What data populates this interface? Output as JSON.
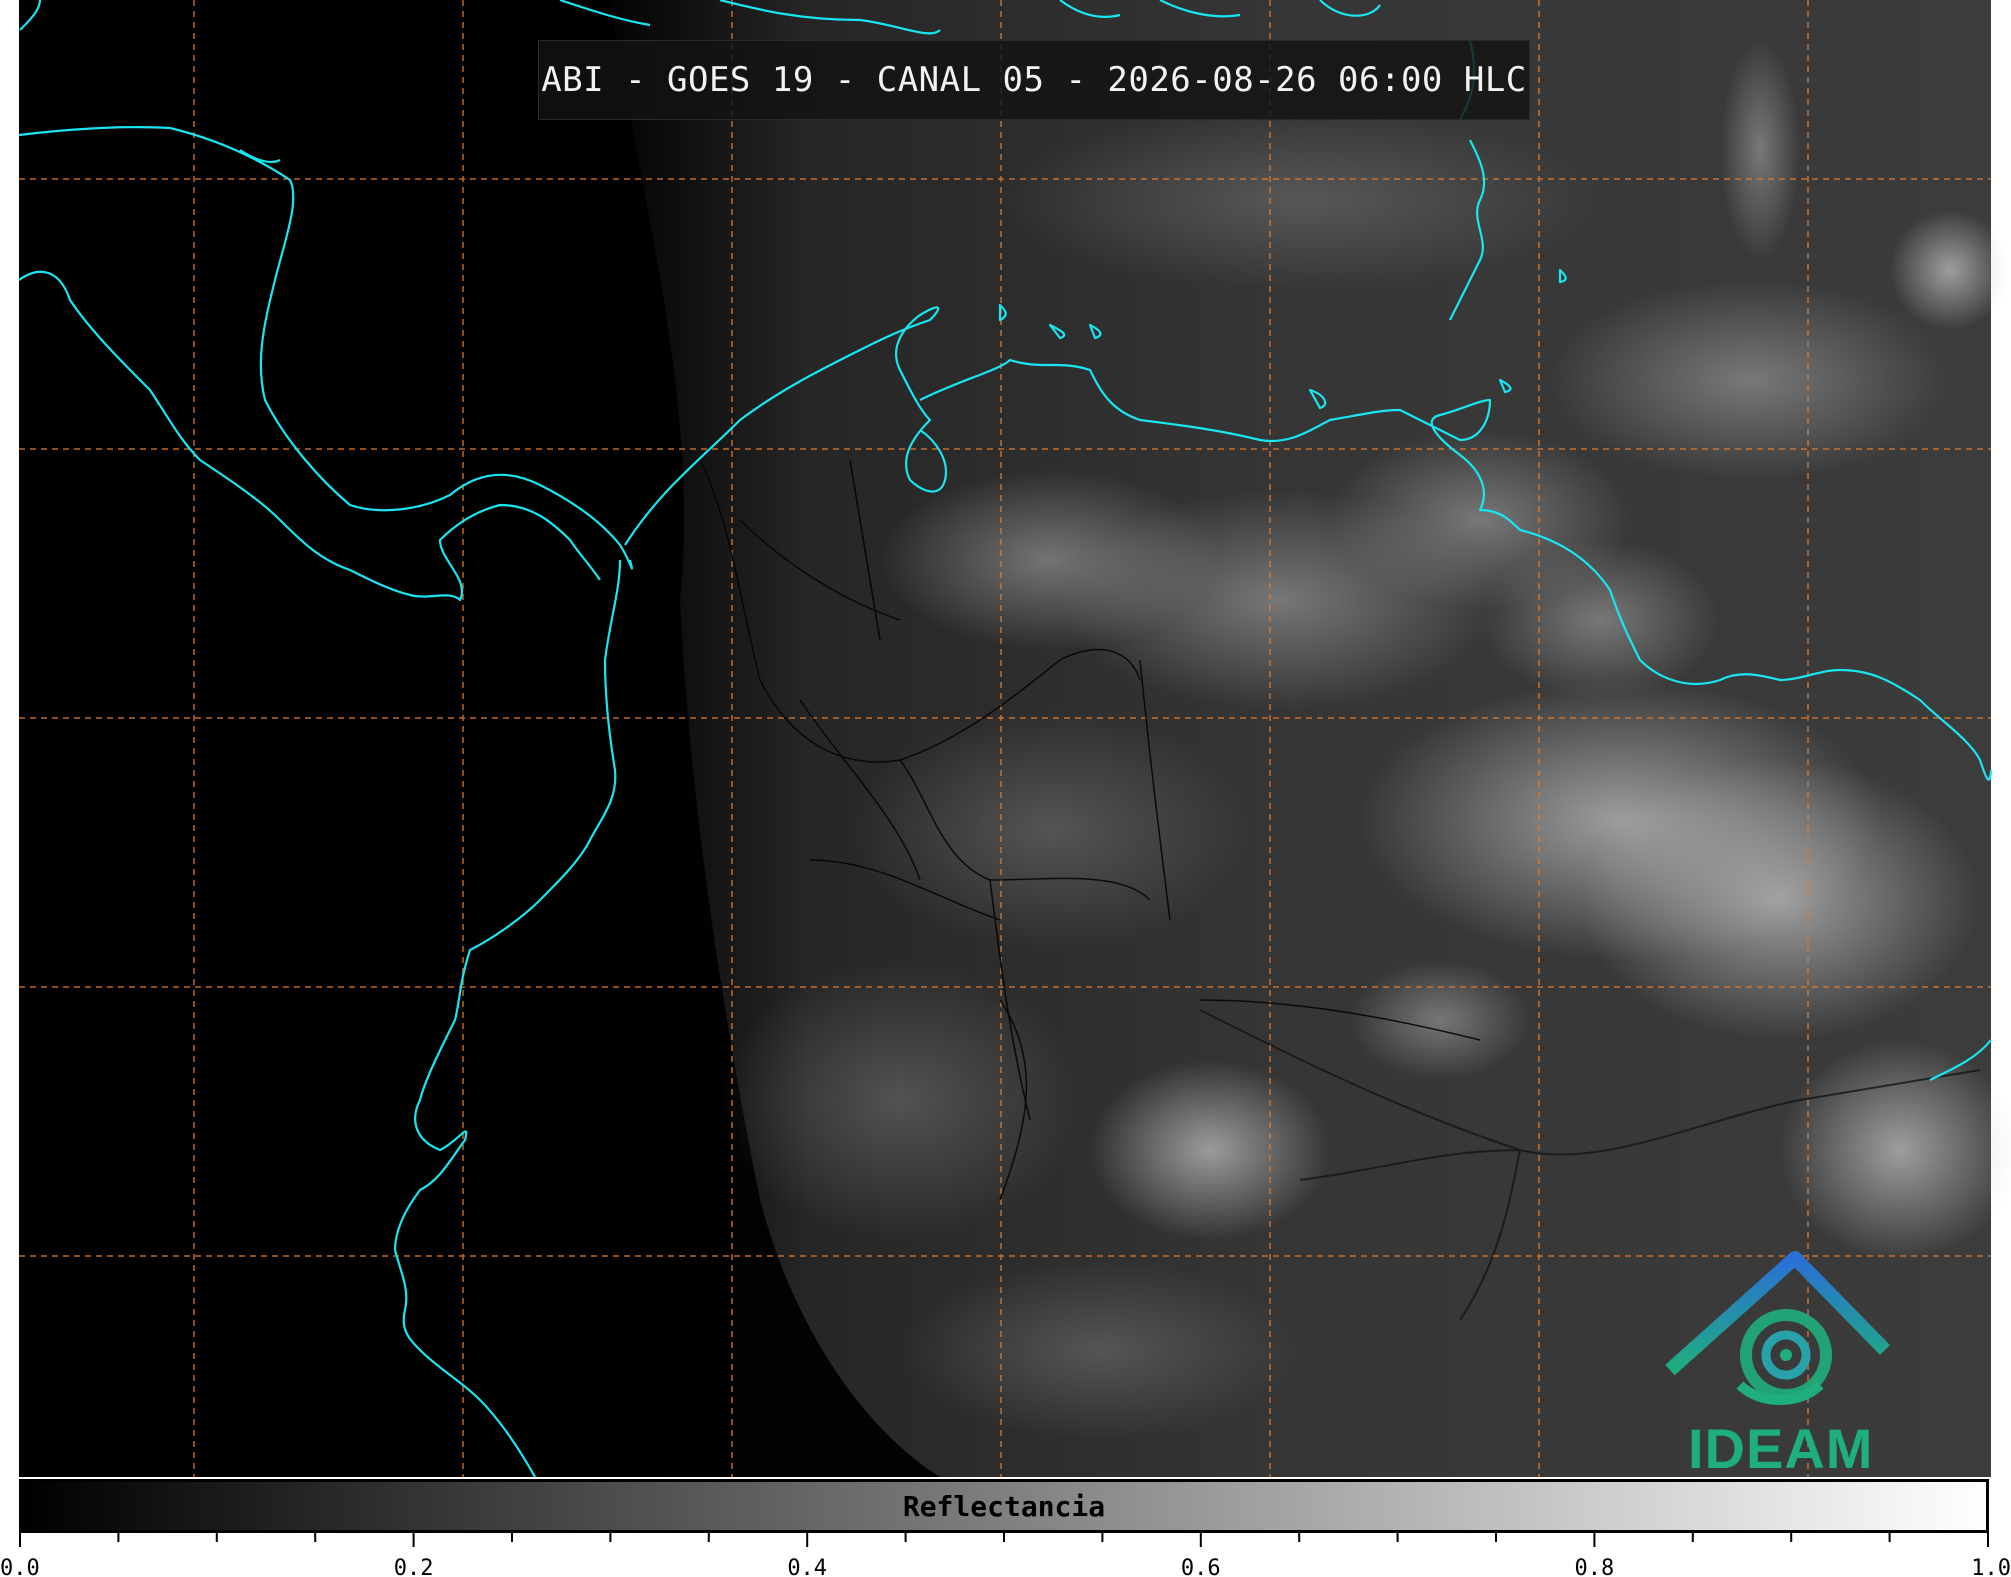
{
  "title": "ABI - GOES 19 - CANAL 05 - 2026-08-26 06:00 HLC",
  "colorbar": {
    "label": "Reflectancia",
    "min": 0.0,
    "max": 1.0,
    "tick_labels": [
      "0.0",
      "0.2",
      "0.4",
      "0.6",
      "0.8",
      "1.0"
    ],
    "minor_step": 0.05
  },
  "logo": {
    "text": "IDEAM"
  },
  "colors": {
    "coastline": "#19e6f0",
    "gridline": "#e07a2e",
    "borders": "#000000",
    "title_bg": "#121212"
  }
}
